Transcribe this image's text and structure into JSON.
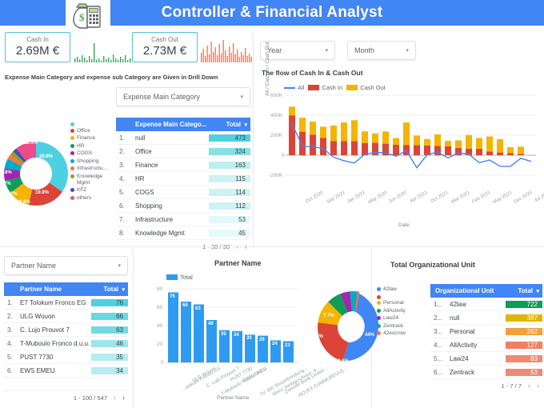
{
  "header": {
    "title": "Controller & Financial Analyst",
    "logo_icon": "money-bag-calculator-icon",
    "bg_color": "#4285f4"
  },
  "kpis": [
    {
      "label": "Cash In",
      "value": "2.69M €",
      "spark_color": "#34a853",
      "spark_icon": "sparkline-cash-in"
    },
    {
      "label": "Cash Out",
      "value": "2.73M €",
      "spark_color": "#ff6d45",
      "spark_icon": "sparkline-cash-out"
    }
  ],
  "expense_panel": {
    "note": "Expense Main Category and expense sub Category are Given in Drill Down",
    "dropdown": {
      "value": "Expense Main Category",
      "caret_icon": "chevron-down-icon"
    },
    "table": {
      "columns": [
        "Expense Main Catego...",
        "Total"
      ],
      "sort_icon": "sort-desc-icon",
      "rows": [
        {
          "idx": "1.",
          "name": "null",
          "total": "473"
        },
        {
          "idx": "2.",
          "name": "Office",
          "total": "324"
        },
        {
          "idx": "3.",
          "name": "Finance",
          "total": "163"
        },
        {
          "idx": "4.",
          "name": "HR",
          "total": "115"
        },
        {
          "idx": "5.",
          "name": "COGS",
          "total": "114"
        },
        {
          "idx": "6.",
          "name": "Shopping",
          "total": "112"
        },
        {
          "idx": "7.",
          "name": "Infrastructure",
          "total": "53"
        },
        {
          "idx": "8.",
          "name": "Knowledge Mgmt",
          "total": "45"
        }
      ],
      "pagination": "1 - 30 / 30",
      "prev_icon": "chevron-left-icon",
      "next_icon": "chevron-right-icon"
    }
  },
  "filters": {
    "year": {
      "value": "Year",
      "caret_icon": "chevron-down-icon"
    },
    "month": {
      "value": "Month",
      "caret_icon": "chevron-down-icon"
    }
  },
  "cashflow_panel": {
    "title": "The flow of Cash In & Cash Out"
  },
  "partner_panel": {
    "dropdown": {
      "value": "Partner Name",
      "caret_icon": "chevron-down-icon"
    },
    "table": {
      "columns": [
        "Partner Name",
        "Total"
      ],
      "sort_icon": "sort-desc-icon",
      "rows": [
        {
          "idx": "1.",
          "name": "E7 Tolokum Fronco EG",
          "total": "76"
        },
        {
          "idx": "2.",
          "name": "ULG Wouon",
          "total": "66"
        },
        {
          "idx": "3.",
          "name": "C. Lujo Prouvot 7",
          "total": "63"
        },
        {
          "idx": "4.",
          "name": "T-Muboulo Fronco d.u.u.",
          "total": "46"
        },
        {
          "idx": "5.",
          "name": "PUST 7730",
          "total": "35"
        },
        {
          "idx": "6.",
          "name": "EWS EMEU",
          "total": "34"
        }
      ],
      "pagination": "1 - 100 / 547",
      "prev_icon": "chevron-left-icon",
      "next_icon": "chevron-right-icon"
    }
  },
  "org_panel": {
    "title": "Total Organizational Unit",
    "table": {
      "columns": [
        "Organizational Unit",
        "Total"
      ],
      "sort_icon": "sort-desc-icon",
      "rows": [
        {
          "idx": "1...",
          "name": "42law",
          "total": "722",
          "color": "#0f9d58"
        },
        {
          "idx": "2...",
          "name": "null",
          "total": "387",
          "color": "#e3b505"
        },
        {
          "idx": "3...",
          "name": "Personal",
          "total": "262",
          "color": "#f2a03d"
        },
        {
          "idx": "4...",
          "name": "AllActivity",
          "total": "127",
          "color": "#ef8060"
        },
        {
          "idx": "5...",
          "name": "Law24",
          "total": "83",
          "color": "#f08a72"
        },
        {
          "idx": "6...",
          "name": "Zentrack",
          "total": "53",
          "color": "#f08a72"
        }
      ],
      "pagination": "1 - 7 / 7",
      "prev_icon": "chevron-left-icon",
      "next_icon": "chevron-right-icon"
    }
  },
  "chart_data": [
    {
      "id": "expense-donut",
      "type": "pie",
      "title": "",
      "legend_position": "right",
      "labels": [
        "",
        "Office",
        "Finance",
        "HR",
        "COGS",
        "Shopping",
        "Infrastructu...",
        "Knowledge Mgmt",
        "KFZ",
        "others"
      ],
      "values": [
        28.8,
        19.8,
        9.9,
        7,
        7,
        6.8,
        2.2,
        2.1,
        2.1,
        12.5
      ],
      "display_labels": [
        "28.8%",
        "19.8%",
        "9.9%",
        "7%",
        "7%",
        "6.8%",
        "",
        "",
        "",
        "12.5%"
      ],
      "colors": [
        "#4dd0e1",
        "#db4437",
        "#f4b400",
        "#0f9d58",
        "#9c27b0",
        "#00acc1",
        "#ff7043",
        "#9e9d24",
        "#3f51b5",
        "#ec4b8c"
      ]
    },
    {
      "id": "cashflow-combo",
      "type": "bar",
      "title": "The flow of Cash In & Cash Out",
      "xlabel": "Date",
      "ylabel": "All / Cash In / Cash Out",
      "ylim": [
        -200000,
        600000
      ],
      "yticks": [
        "600K",
        "400K",
        "200K",
        "0",
        "-200K"
      ],
      "grid": true,
      "legend_position": "top",
      "categories": [
        "Oct 2020",
        "Sep 2021",
        "Jan 2021",
        "May 2020",
        "Jun 2020",
        "Apr 2021",
        "Oct 2021",
        "Mar 2021",
        "Feb 2021",
        "May 2021",
        "Dec 2020",
        "Jul 2021",
        "",
        "",
        "",
        "",
        "",
        "",
        "",
        ""
      ],
      "series": [
        {
          "name": "Cash In",
          "type": "bar",
          "color": "#db4437",
          "values": [
            398000,
            232000,
            205000,
            174000,
            140000,
            140000,
            140000,
            122000,
            123000,
            115000,
            105000,
            103000,
            100000,
            97000,
            93000,
            88000,
            73000,
            64000,
            64000,
            37000,
            27000,
            20000,
            12000
          ]
        },
        {
          "name": "Cash Out",
          "type": "bar",
          "color": "#f4b400",
          "values": [
            87000,
            143000,
            130000,
            111000,
            157000,
            187000,
            210000,
            117000,
            93000,
            123000,
            66000,
            224000,
            96000,
            65000,
            115000,
            55000,
            75000,
            138000,
            108000,
            150000,
            134000,
            60000,
            73000
          ]
        },
        {
          "name": "All",
          "type": "line",
          "color": "#4285f4",
          "values": [
            316000,
            90000,
            85000,
            67000,
            -20000,
            -55000,
            -78000,
            10000,
            28000,
            24000,
            -10000,
            45000,
            -125000,
            5000,
            32000,
            -28000,
            25000,
            10000,
            -75000,
            -48000,
            -110000,
            -113000,
            -30000,
            -62000
          ]
        }
      ]
    },
    {
      "id": "partner-bar",
      "type": "bar",
      "title": "Partner Name",
      "xlabel": "Partner Name",
      "ylabel": "",
      "ylim": [
        0,
        80
      ],
      "yticks": [
        "80",
        "60",
        "40",
        "20",
        "0"
      ],
      "grid": true,
      "legend_position": "top",
      "legend": [
        "Total"
      ],
      "series_color": "#2e9bf0",
      "categories": [
        "...olokum Fronco EG",
        "ULG Wouon",
        "C. Lujo Prouvot 7",
        "T-Muboulo Fronco d.u.u.",
        "PUST 7730",
        "EWS EMEU",
        "TU 360 Stouorborotung...",
        "Monz Vorlogs-Unouv. d...",
        "Zwoodo Bonk Uostor...",
        "NÜVEX EUMMUBEULE..."
      ],
      "values": [
        76,
        66,
        63,
        46,
        35,
        34,
        30,
        29,
        24,
        23
      ]
    },
    {
      "id": "org-donut",
      "type": "pie",
      "title": "Total Organizational Unit",
      "legend_position": "left",
      "labels": [
        "42law",
        "",
        "Personal",
        "AllActivity",
        "Law24",
        "Zentrack",
        "42escrow"
      ],
      "values": [
        44,
        23.6,
        16,
        7.7,
        4.5,
        3.2,
        1.0
      ],
      "display_labels": [
        "44%",
        "23.6%",
        "16%",
        "7.7%",
        "",
        "",
        ""
      ],
      "colors": [
        "#4285f4",
        "#db4437",
        "#f4b400",
        "#0f9d58",
        "#9c27b0",
        "#00acc1",
        "#ff7043"
      ]
    }
  ],
  "cashflow_legend": [
    {
      "name": "All",
      "color": "#4285f4",
      "marker": "line"
    },
    {
      "name": "Cash In",
      "color": "#db4437",
      "marker": "swatch"
    },
    {
      "name": "Cash Out",
      "color": "#f4b400",
      "marker": "swatch"
    }
  ]
}
